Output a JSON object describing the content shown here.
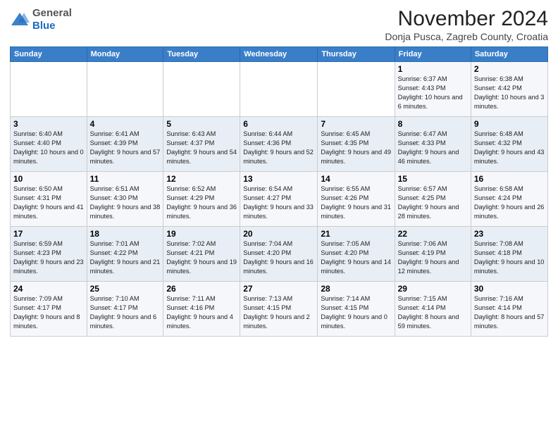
{
  "logo": {
    "general": "General",
    "blue": "Blue"
  },
  "title": "November 2024",
  "subtitle": "Donja Pusca, Zagreb County, Croatia",
  "headers": [
    "Sunday",
    "Monday",
    "Tuesday",
    "Wednesday",
    "Thursday",
    "Friday",
    "Saturday"
  ],
  "weeks": [
    [
      {
        "day": "",
        "info": ""
      },
      {
        "day": "",
        "info": ""
      },
      {
        "day": "",
        "info": ""
      },
      {
        "day": "",
        "info": ""
      },
      {
        "day": "",
        "info": ""
      },
      {
        "day": "1",
        "info": "Sunrise: 6:37 AM\nSunset: 4:43 PM\nDaylight: 10 hours and 6 minutes."
      },
      {
        "day": "2",
        "info": "Sunrise: 6:38 AM\nSunset: 4:42 PM\nDaylight: 10 hours and 3 minutes."
      }
    ],
    [
      {
        "day": "3",
        "info": "Sunrise: 6:40 AM\nSunset: 4:40 PM\nDaylight: 10 hours and 0 minutes."
      },
      {
        "day": "4",
        "info": "Sunrise: 6:41 AM\nSunset: 4:39 PM\nDaylight: 9 hours and 57 minutes."
      },
      {
        "day": "5",
        "info": "Sunrise: 6:43 AM\nSunset: 4:37 PM\nDaylight: 9 hours and 54 minutes."
      },
      {
        "day": "6",
        "info": "Sunrise: 6:44 AM\nSunset: 4:36 PM\nDaylight: 9 hours and 52 minutes."
      },
      {
        "day": "7",
        "info": "Sunrise: 6:45 AM\nSunset: 4:35 PM\nDaylight: 9 hours and 49 minutes."
      },
      {
        "day": "8",
        "info": "Sunrise: 6:47 AM\nSunset: 4:33 PM\nDaylight: 9 hours and 46 minutes."
      },
      {
        "day": "9",
        "info": "Sunrise: 6:48 AM\nSunset: 4:32 PM\nDaylight: 9 hours and 43 minutes."
      }
    ],
    [
      {
        "day": "10",
        "info": "Sunrise: 6:50 AM\nSunset: 4:31 PM\nDaylight: 9 hours and 41 minutes."
      },
      {
        "day": "11",
        "info": "Sunrise: 6:51 AM\nSunset: 4:30 PM\nDaylight: 9 hours and 38 minutes."
      },
      {
        "day": "12",
        "info": "Sunrise: 6:52 AM\nSunset: 4:29 PM\nDaylight: 9 hours and 36 minutes."
      },
      {
        "day": "13",
        "info": "Sunrise: 6:54 AM\nSunset: 4:27 PM\nDaylight: 9 hours and 33 minutes."
      },
      {
        "day": "14",
        "info": "Sunrise: 6:55 AM\nSunset: 4:26 PM\nDaylight: 9 hours and 31 minutes."
      },
      {
        "day": "15",
        "info": "Sunrise: 6:57 AM\nSunset: 4:25 PM\nDaylight: 9 hours and 28 minutes."
      },
      {
        "day": "16",
        "info": "Sunrise: 6:58 AM\nSunset: 4:24 PM\nDaylight: 9 hours and 26 minutes."
      }
    ],
    [
      {
        "day": "17",
        "info": "Sunrise: 6:59 AM\nSunset: 4:23 PM\nDaylight: 9 hours and 23 minutes."
      },
      {
        "day": "18",
        "info": "Sunrise: 7:01 AM\nSunset: 4:22 PM\nDaylight: 9 hours and 21 minutes."
      },
      {
        "day": "19",
        "info": "Sunrise: 7:02 AM\nSunset: 4:21 PM\nDaylight: 9 hours and 19 minutes."
      },
      {
        "day": "20",
        "info": "Sunrise: 7:04 AM\nSunset: 4:20 PM\nDaylight: 9 hours and 16 minutes."
      },
      {
        "day": "21",
        "info": "Sunrise: 7:05 AM\nSunset: 4:20 PM\nDaylight: 9 hours and 14 minutes."
      },
      {
        "day": "22",
        "info": "Sunrise: 7:06 AM\nSunset: 4:19 PM\nDaylight: 9 hours and 12 minutes."
      },
      {
        "day": "23",
        "info": "Sunrise: 7:08 AM\nSunset: 4:18 PM\nDaylight: 9 hours and 10 minutes."
      }
    ],
    [
      {
        "day": "24",
        "info": "Sunrise: 7:09 AM\nSunset: 4:17 PM\nDaylight: 9 hours and 8 minutes."
      },
      {
        "day": "25",
        "info": "Sunrise: 7:10 AM\nSunset: 4:17 PM\nDaylight: 9 hours and 6 minutes."
      },
      {
        "day": "26",
        "info": "Sunrise: 7:11 AM\nSunset: 4:16 PM\nDaylight: 9 hours and 4 minutes."
      },
      {
        "day": "27",
        "info": "Sunrise: 7:13 AM\nSunset: 4:15 PM\nDaylight: 9 hours and 2 minutes."
      },
      {
        "day": "28",
        "info": "Sunrise: 7:14 AM\nSunset: 4:15 PM\nDaylight: 9 hours and 0 minutes."
      },
      {
        "day": "29",
        "info": "Sunrise: 7:15 AM\nSunset: 4:14 PM\nDaylight: 8 hours and 59 minutes."
      },
      {
        "day": "30",
        "info": "Sunrise: 7:16 AM\nSunset: 4:14 PM\nDaylight: 8 hours and 57 minutes."
      }
    ]
  ]
}
